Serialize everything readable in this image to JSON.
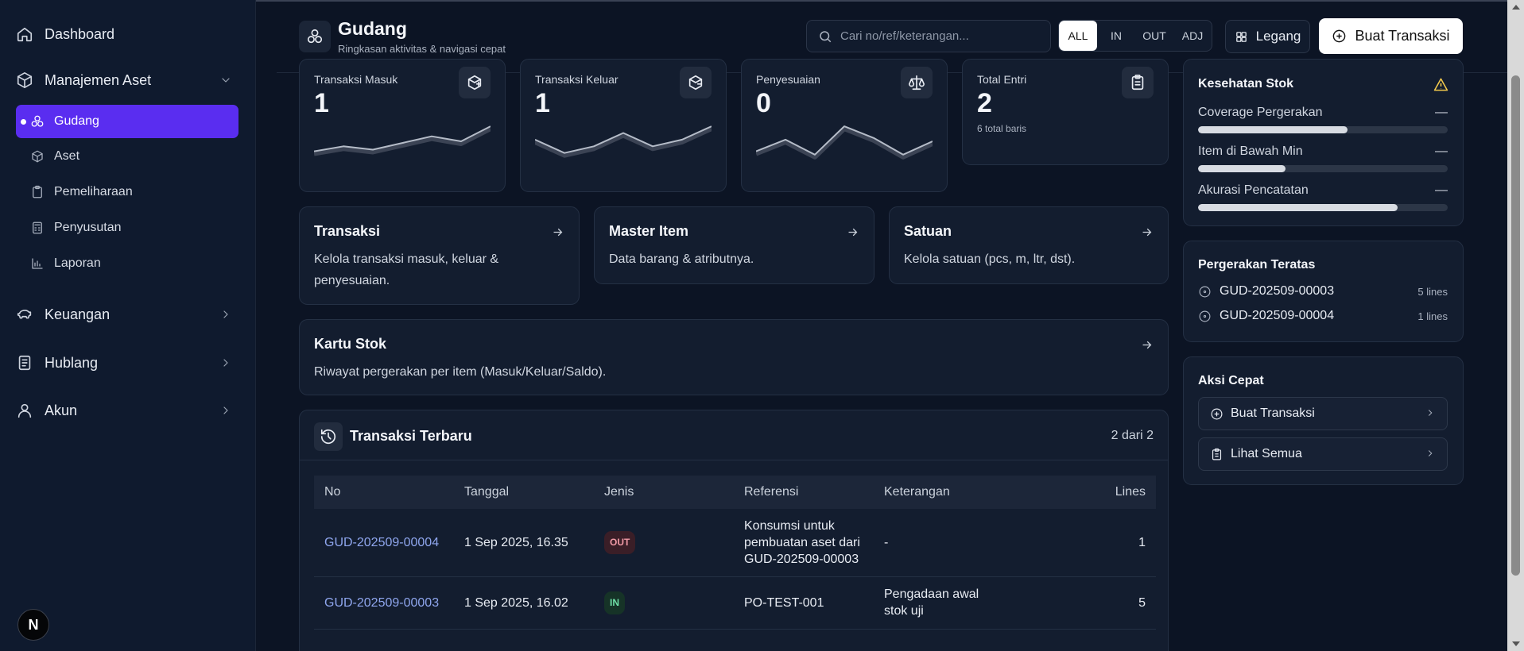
{
  "sidebar": {
    "dashboard": "Dashboard",
    "groups": [
      {
        "label": "Manajemen Aset",
        "icon": "box-icon",
        "expanded": true
      },
      {
        "label": "Keuangan",
        "icon": "piggy-bank-icon"
      },
      {
        "label": "Hublang",
        "icon": "document-icon"
      },
      {
        "label": "Akun",
        "icon": "user-icon"
      }
    ],
    "items": [
      {
        "label": "Gudang",
        "icon": "boxes-icon",
        "active": true
      },
      {
        "label": "Aset",
        "icon": "box-icon"
      },
      {
        "label": "Pemeliharaan",
        "icon": "clipboard-icon"
      },
      {
        "label": "Penyusutan",
        "icon": "calculator-icon"
      },
      {
        "label": "Laporan",
        "icon": "bar-chart-icon"
      }
    ],
    "avatar_letter": "N"
  },
  "header": {
    "title": "Gudang",
    "subtitle": "Ringkasan aktivitas & navigasi cepat",
    "search_placeholder": "Cari no/ref/keterangan...",
    "filters": [
      "ALL",
      "IN",
      "OUT",
      "ADJ"
    ],
    "active_filter": "ALL",
    "layout_button": "Legang",
    "create_button": "Buat Transaksi"
  },
  "stats": [
    {
      "label": "Transaksi Masuk",
      "value": "1",
      "icon": "package-in-icon",
      "spark": [
        0.2,
        0.35,
        0.25,
        0.45,
        0.65,
        0.5,
        0.95
      ]
    },
    {
      "label": "Transaksi Keluar",
      "value": "1",
      "icon": "package-out-icon",
      "spark": [
        0.55,
        0.15,
        0.35,
        0.75,
        0.35,
        0.55,
        0.95
      ]
    },
    {
      "label": "Penyesuaian",
      "value": "0",
      "icon": "scale-icon",
      "spark": [
        0.2,
        0.55,
        0.1,
        0.95,
        0.6,
        0.1,
        0.5
      ]
    },
    {
      "label": "Total Entri",
      "value": "2",
      "icon": "clipboard-icon",
      "note": "6 total baris"
    }
  ],
  "nav_cards": [
    {
      "title": "Transaksi",
      "desc": "Kelola transaksi masuk, keluar & penyesuaian."
    },
    {
      "title": "Master Item",
      "desc": "Data barang & atributnya."
    },
    {
      "title": "Satuan",
      "desc": "Kelola satuan (pcs, m, ltr, dst)."
    },
    {
      "title": "Kartu Stok",
      "desc": "Riwayat pergerakan per item (Masuk/Keluar/Saldo)."
    }
  ],
  "health": {
    "title": "Kesehatan Stok",
    "rows": [
      {
        "label": "Coverage Pergerakan",
        "value": "—",
        "level": 0.6
      },
      {
        "label": "Item di Bawah Min",
        "value": "—",
        "level": 0.35
      },
      {
        "label": "Akurasi Pencatatan",
        "value": "—",
        "level": 0.8
      }
    ]
  },
  "top_moves": {
    "title": "Pergerakan Teratas",
    "rows": [
      {
        "no": "GUD-202509-00003",
        "lines": "5 lines"
      },
      {
        "no": "GUD-202509-00004",
        "lines": "1 lines"
      }
    ]
  },
  "quick": {
    "title": "Aksi Cepat",
    "items": [
      "Buat Transaksi",
      "Lihat Semua"
    ]
  },
  "recent": {
    "title": "Transaksi Terbaru",
    "count": "2 dari 2",
    "columns": [
      "No",
      "Tanggal",
      "Jenis",
      "Referensi",
      "Keterangan",
      "Lines"
    ],
    "rows": [
      {
        "no": "GUD-202509-00004",
        "date": "1 Sep 2025, 16.35",
        "type": "OUT",
        "ref": "Konsumsi untuk pembuatan aset dari GUD-202509-00003",
        "note": "-",
        "lines": "1"
      },
      {
        "no": "GUD-202509-00003",
        "date": "1 Sep 2025, 16.02",
        "type": "IN",
        "ref": "PO-TEST-001",
        "note": "Pengadaan awal stok uji",
        "lines": "5"
      }
    ]
  }
}
